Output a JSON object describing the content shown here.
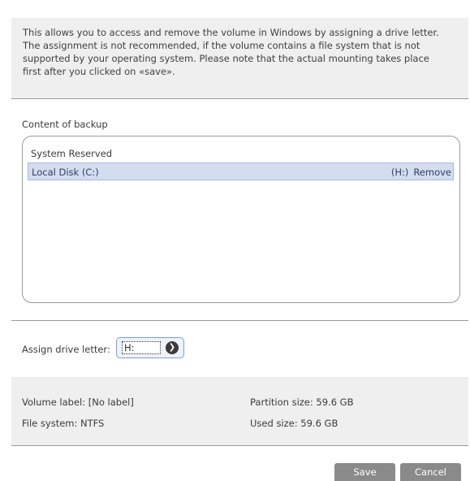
{
  "info": {
    "line1": "This allows you to access and remove the volume in Windows by assigning a drive letter.",
    "line2": "The assignment is not recommended, if the volume contains a file system that is not",
    "line3": "supported by your operating system. Please note that the actual mounting takes place",
    "line4": "first after you clicked on «save»."
  },
  "content": {
    "label": "Content of backup",
    "items": [
      {
        "name": "System Reserved",
        "letter": "",
        "action": ""
      },
      {
        "name": "Local Disk (C:)",
        "letter": "(H:)",
        "action": "Remove"
      }
    ]
  },
  "assign": {
    "label": "Assign drive letter:",
    "value": "H:"
  },
  "details": {
    "volume_label_key": "Volume label:",
    "volume_label_value": "[No label]",
    "file_system_key": "File system:",
    "file_system_value": "NTFS",
    "partition_size_key": "Partition size:",
    "partition_size_value": "59.6 GB",
    "used_size_key": "Used size:",
    "used_size_value": "59.6 GB"
  },
  "buttons": {
    "save": "Save",
    "cancel": "Cancel"
  },
  "colors": {
    "panel_bg": "#efefef",
    "selection_bg": "#d4dcef",
    "button_bg": "#8a8a8a"
  }
}
